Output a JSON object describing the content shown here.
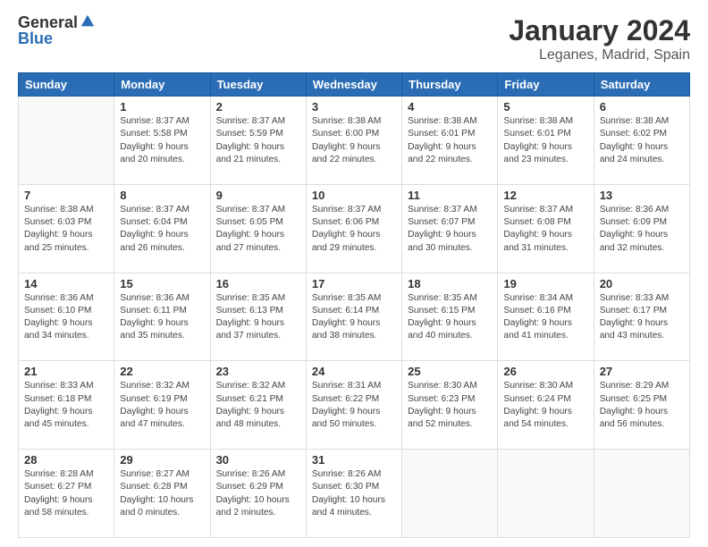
{
  "logo": {
    "general": "General",
    "blue": "Blue"
  },
  "header": {
    "month": "January 2024",
    "location": "Leganes, Madrid, Spain"
  },
  "weekdays": [
    "Sunday",
    "Monday",
    "Tuesday",
    "Wednesday",
    "Thursday",
    "Friday",
    "Saturday"
  ],
  "weeks": [
    [
      {
        "day": "",
        "sunrise": "",
        "sunset": "",
        "daylight": ""
      },
      {
        "day": "1",
        "sunrise": "Sunrise: 8:37 AM",
        "sunset": "Sunset: 5:58 PM",
        "daylight": "Daylight: 9 hours and 20 minutes."
      },
      {
        "day": "2",
        "sunrise": "Sunrise: 8:37 AM",
        "sunset": "Sunset: 5:59 PM",
        "daylight": "Daylight: 9 hours and 21 minutes."
      },
      {
        "day": "3",
        "sunrise": "Sunrise: 8:38 AM",
        "sunset": "Sunset: 6:00 PM",
        "daylight": "Daylight: 9 hours and 22 minutes."
      },
      {
        "day": "4",
        "sunrise": "Sunrise: 8:38 AM",
        "sunset": "Sunset: 6:01 PM",
        "daylight": "Daylight: 9 hours and 22 minutes."
      },
      {
        "day": "5",
        "sunrise": "Sunrise: 8:38 AM",
        "sunset": "Sunset: 6:01 PM",
        "daylight": "Daylight: 9 hours and 23 minutes."
      },
      {
        "day": "6",
        "sunrise": "Sunrise: 8:38 AM",
        "sunset": "Sunset: 6:02 PM",
        "daylight": "Daylight: 9 hours and 24 minutes."
      }
    ],
    [
      {
        "day": "7",
        "sunrise": "Sunrise: 8:38 AM",
        "sunset": "Sunset: 6:03 PM",
        "daylight": "Daylight: 9 hours and 25 minutes."
      },
      {
        "day": "8",
        "sunrise": "Sunrise: 8:37 AM",
        "sunset": "Sunset: 6:04 PM",
        "daylight": "Daylight: 9 hours and 26 minutes."
      },
      {
        "day": "9",
        "sunrise": "Sunrise: 8:37 AM",
        "sunset": "Sunset: 6:05 PM",
        "daylight": "Daylight: 9 hours and 27 minutes."
      },
      {
        "day": "10",
        "sunrise": "Sunrise: 8:37 AM",
        "sunset": "Sunset: 6:06 PM",
        "daylight": "Daylight: 9 hours and 29 minutes."
      },
      {
        "day": "11",
        "sunrise": "Sunrise: 8:37 AM",
        "sunset": "Sunset: 6:07 PM",
        "daylight": "Daylight: 9 hours and 30 minutes."
      },
      {
        "day": "12",
        "sunrise": "Sunrise: 8:37 AM",
        "sunset": "Sunset: 6:08 PM",
        "daylight": "Daylight: 9 hours and 31 minutes."
      },
      {
        "day": "13",
        "sunrise": "Sunrise: 8:36 AM",
        "sunset": "Sunset: 6:09 PM",
        "daylight": "Daylight: 9 hours and 32 minutes."
      }
    ],
    [
      {
        "day": "14",
        "sunrise": "Sunrise: 8:36 AM",
        "sunset": "Sunset: 6:10 PM",
        "daylight": "Daylight: 9 hours and 34 minutes."
      },
      {
        "day": "15",
        "sunrise": "Sunrise: 8:36 AM",
        "sunset": "Sunset: 6:11 PM",
        "daylight": "Daylight: 9 hours and 35 minutes."
      },
      {
        "day": "16",
        "sunrise": "Sunrise: 8:35 AM",
        "sunset": "Sunset: 6:13 PM",
        "daylight": "Daylight: 9 hours and 37 minutes."
      },
      {
        "day": "17",
        "sunrise": "Sunrise: 8:35 AM",
        "sunset": "Sunset: 6:14 PM",
        "daylight": "Daylight: 9 hours and 38 minutes."
      },
      {
        "day": "18",
        "sunrise": "Sunrise: 8:35 AM",
        "sunset": "Sunset: 6:15 PM",
        "daylight": "Daylight: 9 hours and 40 minutes."
      },
      {
        "day": "19",
        "sunrise": "Sunrise: 8:34 AM",
        "sunset": "Sunset: 6:16 PM",
        "daylight": "Daylight: 9 hours and 41 minutes."
      },
      {
        "day": "20",
        "sunrise": "Sunrise: 8:33 AM",
        "sunset": "Sunset: 6:17 PM",
        "daylight": "Daylight: 9 hours and 43 minutes."
      }
    ],
    [
      {
        "day": "21",
        "sunrise": "Sunrise: 8:33 AM",
        "sunset": "Sunset: 6:18 PM",
        "daylight": "Daylight: 9 hours and 45 minutes."
      },
      {
        "day": "22",
        "sunrise": "Sunrise: 8:32 AM",
        "sunset": "Sunset: 6:19 PM",
        "daylight": "Daylight: 9 hours and 47 minutes."
      },
      {
        "day": "23",
        "sunrise": "Sunrise: 8:32 AM",
        "sunset": "Sunset: 6:21 PM",
        "daylight": "Daylight: 9 hours and 48 minutes."
      },
      {
        "day": "24",
        "sunrise": "Sunrise: 8:31 AM",
        "sunset": "Sunset: 6:22 PM",
        "daylight": "Daylight: 9 hours and 50 minutes."
      },
      {
        "day": "25",
        "sunrise": "Sunrise: 8:30 AM",
        "sunset": "Sunset: 6:23 PM",
        "daylight": "Daylight: 9 hours and 52 minutes."
      },
      {
        "day": "26",
        "sunrise": "Sunrise: 8:30 AM",
        "sunset": "Sunset: 6:24 PM",
        "daylight": "Daylight: 9 hours and 54 minutes."
      },
      {
        "day": "27",
        "sunrise": "Sunrise: 8:29 AM",
        "sunset": "Sunset: 6:25 PM",
        "daylight": "Daylight: 9 hours and 56 minutes."
      }
    ],
    [
      {
        "day": "28",
        "sunrise": "Sunrise: 8:28 AM",
        "sunset": "Sunset: 6:27 PM",
        "daylight": "Daylight: 9 hours and 58 minutes."
      },
      {
        "day": "29",
        "sunrise": "Sunrise: 8:27 AM",
        "sunset": "Sunset: 6:28 PM",
        "daylight": "Daylight: 10 hours and 0 minutes."
      },
      {
        "day": "30",
        "sunrise": "Sunrise: 8:26 AM",
        "sunset": "Sunset: 6:29 PM",
        "daylight": "Daylight: 10 hours and 2 minutes."
      },
      {
        "day": "31",
        "sunrise": "Sunrise: 8:26 AM",
        "sunset": "Sunset: 6:30 PM",
        "daylight": "Daylight: 10 hours and 4 minutes."
      },
      {
        "day": "",
        "sunrise": "",
        "sunset": "",
        "daylight": ""
      },
      {
        "day": "",
        "sunrise": "",
        "sunset": "",
        "daylight": ""
      },
      {
        "day": "",
        "sunrise": "",
        "sunset": "",
        "daylight": ""
      }
    ]
  ]
}
